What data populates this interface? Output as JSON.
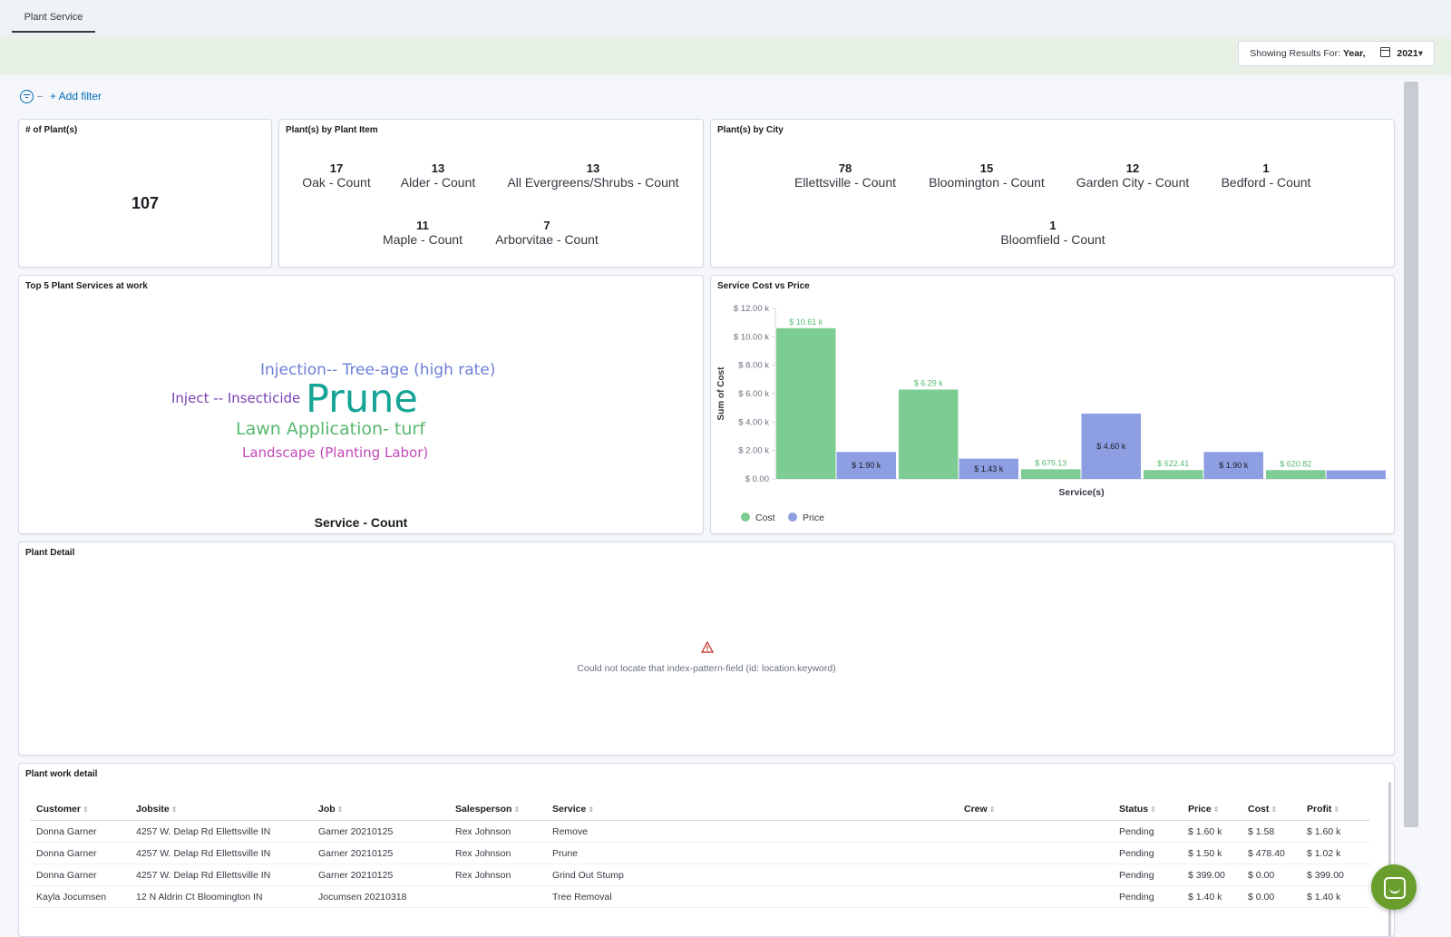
{
  "tab": {
    "label": "Plant Service"
  },
  "header": {
    "showing_prefix": "Showing Results For:",
    "period": "Year,",
    "year": "2021",
    "year_arrow": "▾"
  },
  "filters": {
    "add_label": "+ Add filter"
  },
  "plants_count": {
    "title": "# of Plant(s)",
    "value": "107"
  },
  "by_item": {
    "title": "Plant(s) by Plant Item",
    "metrics": [
      {
        "value": "17",
        "label": "Oak - Count"
      },
      {
        "value": "13",
        "label": "Alder - Count"
      },
      {
        "value": "13",
        "label": "All Evergreens/Shrubs - Count"
      },
      {
        "value": "11",
        "label": "Maple - Count"
      },
      {
        "value": "7",
        "label": "Arborvitae - Count"
      }
    ]
  },
  "by_city": {
    "title": "Plant(s) by City",
    "metrics": [
      {
        "value": "78",
        "label": "Ellettsville - Count"
      },
      {
        "value": "15",
        "label": "Bloomington - Count"
      },
      {
        "value": "12",
        "label": "Garden City - Count"
      },
      {
        "value": "1",
        "label": "Bedford - Count"
      },
      {
        "value": "1",
        "label": "Bloomfield - Count"
      }
    ]
  },
  "services_cloud": {
    "title": "Top 5 Plant Services at work",
    "words": [
      {
        "text": "Injection-- Tree-age (high rate)",
        "color": "#6c7fd6"
      },
      {
        "text": "Inject -- Insecticide",
        "color": "#7a3fb3"
      },
      {
        "text": "Prune",
        "color": "#16a495"
      },
      {
        "text": "Lawn Application- turf",
        "color": "#57b96e"
      },
      {
        "text": "Landscape (Planting Labor)",
        "color": "#c248b8"
      }
    ],
    "footer": "Service - Count"
  },
  "cost_chart": {
    "title": "Service Cost vs Price"
  },
  "chart_data": {
    "type": "bar",
    "title": "Service Cost vs Price",
    "xlabel": "Service(s)",
    "ylabel": "Sum of Cost",
    "ylim": [
      0,
      12000
    ],
    "yticks": [
      "$ 0.00",
      "$ 2.00 k",
      "$ 4.00 k",
      "$ 6.00 k",
      "$ 8.00 k",
      "$ 10.00 k",
      "$ 12.00 k"
    ],
    "legend_position": "bottom-left",
    "categories": [
      "",
      "",
      "",
      "",
      ""
    ],
    "series": [
      {
        "name": "Cost",
        "color": "#7ccc94",
        "label_color": "#57b96e",
        "values": [
          10610,
          6290,
          679.13,
          622.41,
          620.82
        ],
        "labels": [
          "$ 10.61 k",
          "$ 6.29 k",
          "$ 679.13",
          "$ 622.41",
          "$ 620.82"
        ]
      },
      {
        "name": "Price",
        "color": "#8d9ee3",
        "label_color": "#1a1c21",
        "values": [
          1900,
          1430,
          4600,
          1900,
          600
        ],
        "labels": [
          "$ 1.90 k",
          "$ 1.43 k",
          "$ 4.60 k",
          "$ 1.90 k",
          ""
        ]
      }
    ]
  },
  "plant_detail": {
    "title": "Plant Detail",
    "error": "Could not locate that index-pattern-field (id: location.keyword)"
  },
  "work_detail": {
    "title": "Plant work detail",
    "columns": [
      "Customer",
      "Jobsite",
      "Job",
      "Salesperson",
      "Service",
      "Crew",
      "Status",
      "Price",
      "Cost",
      "Profit"
    ],
    "rows": [
      [
        "Donna Garner",
        "4257 W. Delap Rd Ellettsville IN",
        "Garner 20210125",
        "Rex Johnson",
        "Remove",
        "",
        "Pending",
        "$ 1.60 k",
        "$ 1.58",
        "$ 1.60 k"
      ],
      [
        "Donna Garner",
        "4257 W. Delap Rd Ellettsville IN",
        "Garner 20210125",
        "Rex Johnson",
        "Prune",
        "",
        "Pending",
        "$ 1.50 k",
        "$ 478.40",
        "$ 1.02 k"
      ],
      [
        "Donna Garner",
        "4257 W. Delap Rd Ellettsville IN",
        "Garner 20210125",
        "Rex Johnson",
        "Grind Out Stump",
        "",
        "Pending",
        "$ 399.00",
        "$ 0.00",
        "$ 399.00"
      ],
      [
        "Kayla Jocumsen",
        "12 N Aldrin Ct Bloomington IN",
        "Jocumsen 20210318",
        "",
        "Tree Removal",
        "",
        "Pending",
        "$ 1.40 k",
        "$ 0.00",
        "$ 1.40 k"
      ]
    ]
  }
}
